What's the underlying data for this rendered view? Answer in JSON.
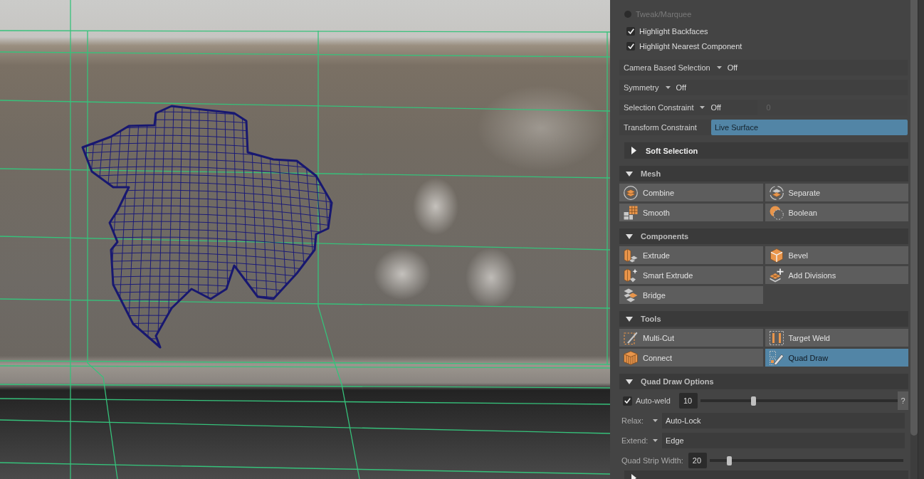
{
  "selection": {
    "radios": [
      {
        "label": "Tweak/Marquee",
        "selected": false,
        "disabled": true
      }
    ],
    "checkboxes": [
      {
        "label": "Highlight Backfaces",
        "checked": true
      },
      {
        "label": "Highlight Nearest Component",
        "checked": true
      }
    ],
    "rows": [
      {
        "kind": "dropdown",
        "label": "Camera Based Selection",
        "value": "Off"
      },
      {
        "kind": "dropdown",
        "label": "Symmetry",
        "value": "Off"
      },
      {
        "kind": "dropdown",
        "label": "Selection Constraint",
        "value": "Off",
        "number": "0",
        "number_disabled": true
      },
      {
        "kind": "field",
        "label": "Transform Constraint",
        "value": "Live Surface",
        "highlighted": true
      }
    ]
  },
  "sections": [
    {
      "kind": "subsection",
      "title": "Soft Selection",
      "expanded": false
    },
    {
      "kind": "section",
      "title": "Mesh",
      "expanded": true,
      "buttons": [
        {
          "label": "Combine",
          "selected": false
        },
        {
          "label": "Separate",
          "selected": false
        },
        {
          "label": "Smooth",
          "selected": false
        },
        {
          "label": "Boolean",
          "selected": false
        }
      ]
    },
    {
      "kind": "section",
      "title": "Components",
      "expanded": true,
      "buttons": [
        {
          "label": "Extrude",
          "selected": false
        },
        {
          "label": "Bevel",
          "selected": false
        },
        {
          "label": "Smart Extrude",
          "selected": false
        },
        {
          "label": "Add Divisions",
          "selected": false
        },
        {
          "label": "Bridge",
          "selected": false
        }
      ]
    },
    {
      "kind": "section",
      "title": "Tools",
      "expanded": true,
      "buttons": [
        {
          "label": "Multi-Cut",
          "selected": false
        },
        {
          "label": "Target Weld",
          "selected": false
        },
        {
          "label": "Connect",
          "selected": false
        },
        {
          "label": "Quad Draw",
          "selected": true
        }
      ]
    },
    {
      "kind": "section",
      "title": "Quad Draw Options",
      "expanded": true,
      "options": [
        {
          "kind": "checkbox-slider",
          "label": "Auto-weld",
          "checked": true,
          "value": "10",
          "level": 0.27,
          "help": "?"
        },
        {
          "kind": "dropdown",
          "label": "Relax:",
          "value": "Auto-Lock"
        },
        {
          "kind": "dropdown",
          "label": "Extend:",
          "value": "Edge"
        },
        {
          "kind": "slider",
          "label": "Quad Strip Width:",
          "value": "20",
          "level": 0.1
        }
      ]
    },
    {
      "kind": "subsection",
      "expanded": false
    }
  ]
}
